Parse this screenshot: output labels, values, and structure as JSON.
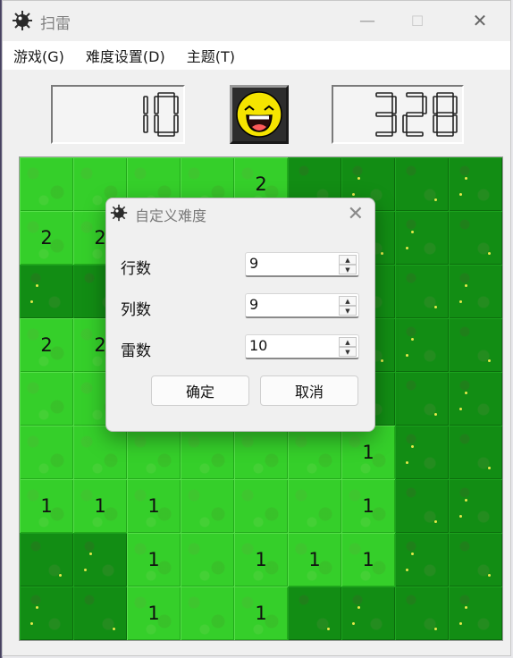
{
  "window": {
    "title": "扫雷",
    "minimize_glyph": "—",
    "maximize_glyph": "☐",
    "close_glyph": "✕"
  },
  "menu": [
    "游戏(G)",
    "难度设置(D)",
    "主题(T)"
  ],
  "status": {
    "mines_left": "10",
    "timer": "328",
    "face": "laughing-smiley"
  },
  "board": {
    "cells": [
      [
        "o",
        "o",
        "o",
        "o",
        "2",
        "c",
        "c",
        "c",
        "c"
      ],
      [
        "2",
        "2",
        "o",
        "o",
        "o",
        "c",
        "c",
        "c",
        "c"
      ],
      [
        "c",
        "c",
        "o",
        "o",
        "o",
        "c",
        "c",
        "c",
        "c"
      ],
      [
        "2",
        "2",
        "o",
        "o",
        "o",
        "c",
        "c",
        "c",
        "c"
      ],
      [
        "o",
        "o",
        "o",
        "o",
        "o",
        "c",
        "c",
        "c",
        "c"
      ],
      [
        "o",
        "o",
        "o",
        "o",
        "o",
        "o",
        "1",
        "c",
        "c"
      ],
      [
        "1",
        "1",
        "1",
        "o",
        "o",
        "o",
        "1",
        "c",
        "c"
      ],
      [
        "c",
        "c",
        "1",
        "o",
        "1",
        "1",
        "1",
        "c",
        "c"
      ],
      [
        "c",
        "c",
        "1",
        "o",
        "1",
        "c",
        "c",
        "c",
        "c"
      ]
    ]
  },
  "dialog": {
    "title": "自定义难度",
    "close_glyph": "✕",
    "fields": [
      {
        "label": "行数",
        "value": "9"
      },
      {
        "label": "列数",
        "value": "9"
      },
      {
        "label": "雷数",
        "value": "10"
      }
    ],
    "ok_label": "确定",
    "cancel_label": "取消"
  },
  "colors": {
    "open_cell": "#35cf2a",
    "closed_cell": "#128d14",
    "digit": "#111111",
    "lcd_digit": "#222222"
  }
}
